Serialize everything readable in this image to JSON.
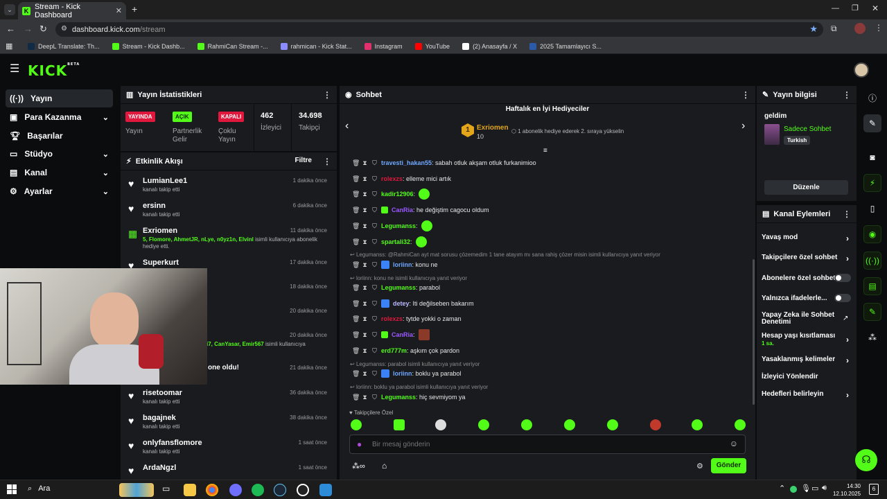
{
  "browser": {
    "tab_title": "Stream - Kick Dashboard",
    "url_host": "dashboard.kick.com",
    "url_path": "/stream",
    "bookmarks": [
      {
        "label": "DeepL Translate: Th...",
        "color": "#0f2b46"
      },
      {
        "label": "Stream - Kick Dashb...",
        "color": "#53fc18"
      },
      {
        "label": "RahmiCan Stream -...",
        "color": "#53fc18"
      },
      {
        "label": "rahmican - Kick Stat...",
        "color": "#8a8cff"
      },
      {
        "label": "Instagram",
        "color": "#e1306c"
      },
      {
        "label": "YouTube",
        "color": "#ff0000"
      },
      {
        "label": "(2) Anasayfa / X",
        "color": "#ffffff"
      },
      {
        "label": "2025 Tamamlayıcı S...",
        "color": "#2b5aa8"
      }
    ]
  },
  "kick": {
    "logo": "KICK",
    "logo_sup": "BETA"
  },
  "sidebar": {
    "items": [
      {
        "label": "Yayın",
        "icon": "broadcast-icon"
      },
      {
        "label": "Para Kazanma",
        "icon": "money-icon"
      },
      {
        "label": "Başarılar",
        "icon": "trophy-icon"
      },
      {
        "label": "Stüdyo",
        "icon": "monitor-icon"
      },
      {
        "label": "Kanal",
        "icon": "channel-icon"
      },
      {
        "label": "Ayarlar",
        "icon": "gear-icon"
      }
    ]
  },
  "stats": {
    "title": "Yayın İstatistikleri",
    "items": [
      {
        "badge": "YAYINDA",
        "badge_color": "#e0183d",
        "badge_text_color": "#ffffff",
        "label": "Yayın"
      },
      {
        "badge": "AÇIK",
        "badge_color": "#53fc18",
        "badge_text_color": "#0b2a00",
        "label": "Partnerlik Gelir"
      },
      {
        "badge": "KAPALI",
        "badge_color": "#e0183d",
        "badge_text_color": "#ffffff",
        "label": "Çoklu Yayın"
      },
      {
        "value": "462",
        "label": "İzleyici"
      },
      {
        "value": "34.698",
        "label": "Takipçi"
      }
    ]
  },
  "activity": {
    "title": "Etkinlik Akışı",
    "filter": "Filtre",
    "events": [
      {
        "name": "LumianLee1",
        "sub": "kanalı takip etti",
        "time": "1 dakika önce"
      },
      {
        "name": "ersinn",
        "sub": "kanalı takip etti",
        "time": "6 dakika önce"
      },
      {
        "name": "Exriomen",
        "sub_highlight": "5, Flomore, AhmetJR, nLye, n0yz1n, Elvinl",
        "sub": "isimli kullanıcıya abonelik hediye etti.",
        "time": "11 dakika önce"
      },
      {
        "name": "Superkurt",
        "sub": "",
        "time": "17 dakika önce"
      },
      {
        "time": "18 dakika önce"
      },
      {
        "time": "20 dakika önce"
      },
      {
        "sub_highlight": "enfi7, CanYasar, Emir567",
        "sub": "isimli kullanıcıya",
        "time": "20 dakika önce"
      },
      {
        "sub": "one oldu!",
        "time": "21 dakika önce"
      },
      {
        "name": "risetoomar",
        "sub": "kanalı takip etti",
        "time": "36 dakika önce"
      },
      {
        "name": "bagajnek",
        "sub": "kanalı takip etti",
        "time": "38 dakika önce"
      },
      {
        "name": "onlyfansflomore",
        "sub": "kanalı takip etti",
        "time": "1 saat önce"
      },
      {
        "name": "ArdaNgzl",
        "sub": "",
        "time": "1 saat önce"
      }
    ]
  },
  "chat": {
    "title": "Sohbet",
    "gifters": {
      "title": "Haftalık en İyi Hediyeciler",
      "rank": "1",
      "name": "Exriomen",
      "count": "10",
      "note": "1 abonelik hediye ederek 2. sıraya yükselin"
    },
    "messages": [
      {
        "user": "travesti_hakan55",
        "color": "#6fa8ff",
        "text": ": sabah otluk akşam otluk furkanimioo"
      },
      {
        "user": "rolexzs",
        "color": "#e0183d",
        "text": ": elleme mici artık"
      },
      {
        "user": "kadir12906",
        "color": "#53fc18",
        "text": ":"
      },
      {
        "user": "CanRia",
        "color": "#9b59ff",
        "text": ": he değiştim cagocu oldum"
      },
      {
        "user": "Legumanss",
        "color": "#53fc18",
        "text": ":"
      },
      {
        "user": "spartali32",
        "color": "#53fc18",
        "text": ":"
      },
      {
        "reply": "Legumanss: @RahmiCan ayt mat sorusu çözemedim 1 tane atayım mı sana rahiş çözer misin isimli kullanıcıya yanıt veriyor"
      },
      {
        "user": "loriinn",
        "color": "#6fa8ff",
        "text": ": konu ne"
      },
      {
        "reply": "loriinn: konu ne isimli kullanıcıya yanıt veriyor"
      },
      {
        "user": "Legumanss",
        "color": "#53fc18",
        "text": ": parabol"
      },
      {
        "user": "detey",
        "color": "#b9b9ff",
        "text": ": Iti değilseben bakarım"
      },
      {
        "user": "rolexzs",
        "color": "#e0183d",
        "text": ": tytde yokki o zaman"
      },
      {
        "user": "CanRia",
        "color": "#9b59ff",
        "text": ":"
      },
      {
        "user": "erd777m",
        "color": "#53fc18",
        "text": ": aşkım çok pardon"
      },
      {
        "reply": "Legumanss: parabol isimli kullanıcıya yanıt veriyor"
      },
      {
        "user": "loriinn",
        "color": "#6fa8ff",
        "text": ": boklu ya parabol"
      },
      {
        "reply": "loriinn: boklu ya parabol isimli kullanıcıya yanıt veriyor"
      },
      {
        "user": "Legumanss",
        "color": "#53fc18",
        "text": ": hiç sevmiyom ya"
      }
    ],
    "followers_only": "Takipçilere Özel",
    "input_placeholder": "Bir mesaj gönderin",
    "send": "Gönder"
  },
  "stream_info": {
    "title": "Yayın bilgisi",
    "stream_title": "geldim",
    "category": "Sadece Sohbet",
    "language": "Turkish",
    "edit": "Düzenle"
  },
  "channel_actions": {
    "title": "Kanal Eylemleri",
    "items": [
      {
        "label": "Yavaş mod",
        "type": "arrow"
      },
      {
        "label": "Takipçilere özel sohbet",
        "type": "arrow"
      },
      {
        "label": "Abonelere özel sohbet",
        "type": "toggle"
      },
      {
        "label": "Yalnızca ifadelerle...",
        "type": "toggle"
      },
      {
        "label": "Yapay Zeka ile Sohbet Denetimi",
        "type": "external"
      },
      {
        "label": "Hesap yaşı kısıtlaması",
        "sub": "1 sa.",
        "type": "arrow"
      },
      {
        "label": "Yasaklanmış kelimeler",
        "type": "arrow"
      },
      {
        "label": "İzleyici Yönlendir",
        "type": "none"
      },
      {
        "label": "Hedefleri belirleyin",
        "type": "arrow"
      }
    ]
  },
  "taskbar": {
    "search": "Ara",
    "time": "14:30",
    "date": "12.10.2025",
    "notif": "6"
  }
}
